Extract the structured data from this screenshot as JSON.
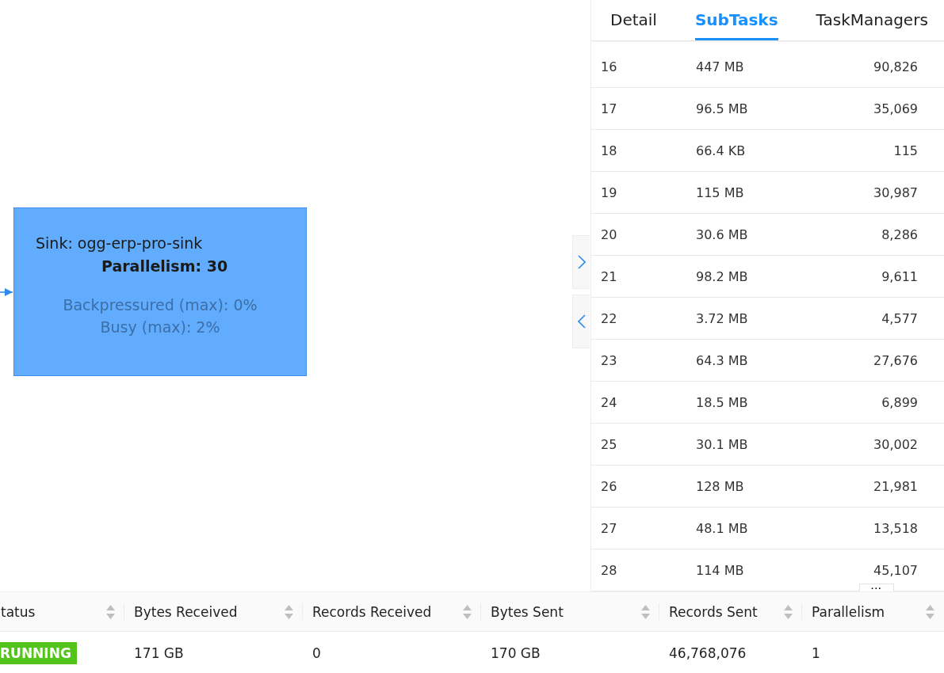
{
  "graph": {
    "node": {
      "title": "Sink: ogg-erp-pro-sink",
      "parallelism": "Parallelism: 30",
      "metrics": [
        "Backpressured (max): 0%",
        "Busy (max): 2%"
      ]
    }
  },
  "drawer": {
    "tabs": [
      {
        "label": "Detail",
        "selected": false
      },
      {
        "label": "SubTasks",
        "selected": true
      },
      {
        "label": "TaskManagers",
        "selected": false
      }
    ],
    "rows": [
      [
        "16",
        "447 MB",
        "90,826"
      ],
      [
        "17",
        "96.5 MB",
        "35,069"
      ],
      [
        "18",
        "66.4 KB",
        "115"
      ],
      [
        "19",
        "115 MB",
        "30,987"
      ],
      [
        "20",
        "30.6 MB",
        "8,286"
      ],
      [
        "21",
        "98.2 MB",
        "9,611"
      ],
      [
        "22",
        "3.72 MB",
        "4,577"
      ],
      [
        "23",
        "64.3 MB",
        "27,676"
      ],
      [
        "24",
        "18.5 MB",
        "6,899"
      ],
      [
        "25",
        "30.1 MB",
        "30,002"
      ],
      [
        "26",
        "128 MB",
        "21,981"
      ],
      [
        "27",
        "48.1 MB",
        "13,518"
      ],
      [
        "28",
        "114 MB",
        "45,107"
      ]
    ],
    "resize_handle": "···"
  },
  "table": {
    "columns": [
      "tatus",
      "Bytes Received",
      "Records Received",
      "Bytes Sent",
      "Records Sent",
      "Parallelism"
    ],
    "rows": [
      {
        "cells": [
          "RUNNING",
          "171 GB",
          "0",
          "170 GB",
          "46,768,076",
          "1"
        ]
      }
    ]
  }
}
